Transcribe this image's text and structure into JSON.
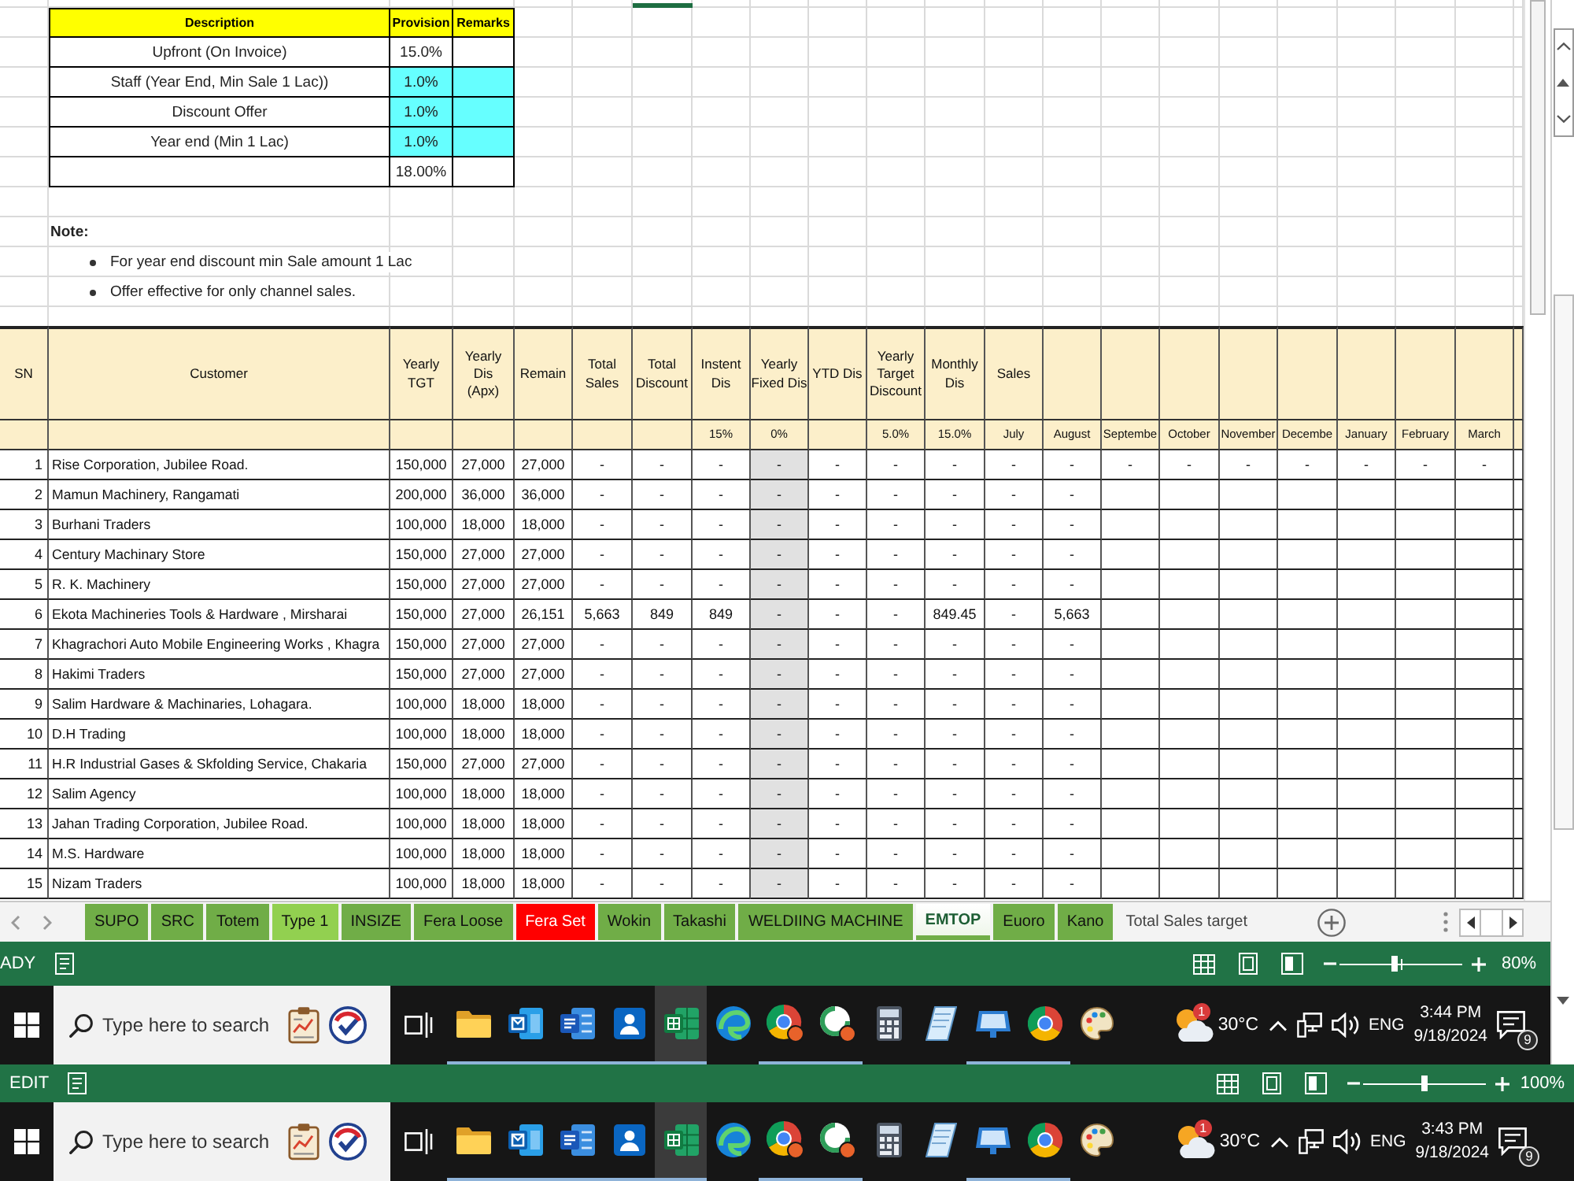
{
  "provision_table": {
    "headers": [
      "Description",
      "Provision",
      "Remarks"
    ],
    "rows": [
      {
        "description": "Upfront (On Invoice)",
        "provision": "15.0%",
        "highlighted": false
      },
      {
        "description": "Staff (Year End, Min Sale 1 Lac))",
        "provision": "1.0%",
        "highlighted": true
      },
      {
        "description": "Discount Offer",
        "provision": "1.0%",
        "highlighted": true
      },
      {
        "description": "Year end (Min 1 Lac)",
        "provision": "1.0%",
        "highlighted": true
      }
    ],
    "total": "18.00%"
  },
  "note": {
    "title": "Note:",
    "bullets": [
      "For year end discount min Sale amount 1 Lac",
      "Offer effective for only channel sales."
    ]
  },
  "table": {
    "columns": [
      {
        "kind": "index",
        "label": "SN",
        "shaded": false
      },
      {
        "kind": "name",
        "label": "Customer",
        "shaded": false
      },
      {
        "kind": "value",
        "label": "Yearly\nTGT",
        "shaded": false
      },
      {
        "kind": "value",
        "label": "Yearly\nDis\n(Apx)",
        "shaded": false
      },
      {
        "kind": "value",
        "label": "Remain",
        "shaded": false
      },
      {
        "kind": "value",
        "label": "Total\nSales",
        "shaded": false
      },
      {
        "kind": "value",
        "label": "Total\nDiscount",
        "shaded": false
      },
      {
        "kind": "value",
        "label": "Instent\nDis",
        "sub": "15%",
        "shaded": false
      },
      {
        "kind": "value",
        "label": "Yearly\nFixed Dis",
        "sub": "0%",
        "shaded": true
      },
      {
        "kind": "value",
        "label": "YTD Dis",
        "shaded": false
      },
      {
        "kind": "value",
        "label": "Yearly\nTarget\nDiscount",
        "sub": "5.0%",
        "shaded": false
      },
      {
        "kind": "value",
        "label": "Monthly\nDis",
        "sub": "15.0%",
        "shaded": false
      },
      {
        "kind": "value",
        "label": "Sales",
        "sub": "July",
        "shaded": false
      },
      {
        "kind": "value",
        "sub": "August",
        "shaded": false
      },
      {
        "kind": "value",
        "sub": "Septembe",
        "shaded": false
      },
      {
        "kind": "value",
        "sub": "October",
        "shaded": false
      },
      {
        "kind": "value",
        "sub": "November",
        "shaded": false
      },
      {
        "kind": "value",
        "sub": "Decembe",
        "shaded": false
      },
      {
        "kind": "value",
        "sub": "January",
        "shaded": false
      },
      {
        "kind": "value",
        "sub": "February",
        "shaded": false
      },
      {
        "kind": "value",
        "sub": "March",
        "shaded": false
      }
    ],
    "rows": [
      {
        "sn": "1",
        "customer": "Rise Corporation, Jubilee Road.",
        "values": [
          "150,000",
          "27,000",
          "27,000",
          "-",
          "-",
          "-",
          "-",
          "-",
          "-",
          "-",
          "-",
          "-",
          "-",
          "-",
          "-",
          "-",
          "-",
          "-",
          "-"
        ]
      },
      {
        "sn": "2",
        "customer": "Mamun Machinery, Rangamati",
        "values": [
          "200,000",
          "36,000",
          "36,000",
          "-",
          "-",
          "-",
          "-",
          "-",
          "-",
          "-",
          "-",
          "-"
        ]
      },
      {
        "sn": "3",
        "customer": "Burhani Traders",
        "values": [
          "100,000",
          "18,000",
          "18,000",
          "-",
          "-",
          "-",
          "-",
          "-",
          "-",
          "-",
          "-",
          "-"
        ]
      },
      {
        "sn": "4",
        "customer": "Century Machinary Store",
        "values": [
          "150,000",
          "27,000",
          "27,000",
          "-",
          "-",
          "-",
          "-",
          "-",
          "-",
          "-",
          "-",
          "-"
        ]
      },
      {
        "sn": "5",
        "customer": "R. K. Machinery",
        "values": [
          "150,000",
          "27,000",
          "27,000",
          "-",
          "-",
          "-",
          "-",
          "-",
          "-",
          "-",
          "-",
          "-"
        ]
      },
      {
        "sn": "6",
        "customer": "Ekota Machineries Tools & Hardware , Mirsharai",
        "values": [
          "150,000",
          "27,000",
          "26,151",
          "5,663",
          "849",
          "849",
          "-",
          "-",
          "-",
          "849.45",
          "-",
          "5,663"
        ]
      },
      {
        "sn": "7",
        "customer": "Khagrachori Auto Mobile Engineering Works , Khagra",
        "values": [
          "150,000",
          "27,000",
          "27,000",
          "-",
          "-",
          "-",
          "-",
          "-",
          "-",
          "-",
          "-",
          "-"
        ]
      },
      {
        "sn": "8",
        "customer": "Hakimi Traders",
        "values": [
          "150,000",
          "27,000",
          "27,000",
          "-",
          "-",
          "-",
          "-",
          "-",
          "-",
          "-",
          "-",
          "-"
        ]
      },
      {
        "sn": "9",
        "customer": "Salim Hardware & Machinaries, Lohagara.",
        "values": [
          "100,000",
          "18,000",
          "18,000",
          "-",
          "-",
          "-",
          "-",
          "-",
          "-",
          "-",
          "-",
          "-"
        ]
      },
      {
        "sn": "10",
        "customer": "D.H Trading",
        "values": [
          "100,000",
          "18,000",
          "18,000",
          "-",
          "-",
          "-",
          "-",
          "-",
          "-",
          "-",
          "-",
          "-"
        ]
      },
      {
        "sn": "11",
        "customer": "H.R Industrial Gases & Skfolding Service, Chakaria",
        "values": [
          "150,000",
          "27,000",
          "27,000",
          "-",
          "-",
          "-",
          "-",
          "-",
          "-",
          "-",
          "-",
          "-"
        ]
      },
      {
        "sn": "12",
        "customer": "Salim Agency",
        "values": [
          "100,000",
          "18,000",
          "18,000",
          "-",
          "-",
          "-",
          "-",
          "-",
          "-",
          "-",
          "-",
          "-"
        ]
      },
      {
        "sn": "13",
        "customer": "Jahan Trading Corporation, Jubilee Road.",
        "values": [
          "100,000",
          "18,000",
          "18,000",
          "-",
          "-",
          "-",
          "-",
          "-",
          "-",
          "-",
          "-",
          "-"
        ]
      },
      {
        "sn": "14",
        "customer": "M.S. Hardware",
        "values": [
          "100,000",
          "18,000",
          "18,000",
          "-",
          "-",
          "-",
          "-",
          "-",
          "-",
          "-",
          "-",
          "-"
        ]
      },
      {
        "sn": "15",
        "customer": "Nizam Traders",
        "values": [
          "100,000",
          "18,000",
          "18,000",
          "-",
          "-",
          "-",
          "-",
          "-",
          "-",
          "-",
          "-",
          "-"
        ]
      }
    ]
  },
  "sheet_tabs": [
    {
      "label": "SUPO",
      "color": "#70ad47",
      "selected": false
    },
    {
      "label": "SRC",
      "color": "#70ad47",
      "selected": false
    },
    {
      "label": "Totem",
      "color": "#70ad47",
      "selected": false
    },
    {
      "label": "Type 1",
      "color": "#92d050",
      "selected": false
    },
    {
      "label": "INSIZE",
      "color": "#70ad47",
      "selected": false
    },
    {
      "label": "Fera Loose",
      "color": "#70ad47",
      "selected": false
    },
    {
      "label": "Fera Set",
      "color": "#ff0000",
      "selected": false
    },
    {
      "label": "Wokin",
      "color": "#70ad47",
      "selected": false
    },
    {
      "label": "Takashi",
      "color": "#70ad47",
      "selected": false
    },
    {
      "label": "WELDIING MACHINE",
      "color": "#70ad47",
      "selected": false
    },
    {
      "label": "EMTOP",
      "color": "#70ad47",
      "selected": true
    },
    {
      "label": "Euoro",
      "color": "#70ad47",
      "selected": false
    },
    {
      "label": "Kano",
      "color": "#70ad47",
      "selected": false
    },
    {
      "label": "Total Sales target",
      "selected": false
    }
  ],
  "footers": [
    {
      "status_bar": {
        "mode": "ADY",
        "zoom": "80%",
        "level": 0.45
      },
      "taskbar": {
        "search": {
          "placeholder": "Type here to search"
        },
        "apps": [
          {
            "kind": "folder",
            "running": true,
            "selected": false
          },
          {
            "kind": "mail",
            "running": true,
            "selected": false
          },
          {
            "kind": "document",
            "running": true,
            "selected": false
          },
          {
            "kind": "profile",
            "running": true,
            "selected": false
          },
          {
            "kind": "spreadsheet",
            "running": true,
            "selected": true
          },
          {
            "kind": "swirl",
            "running": false,
            "selected": false
          },
          {
            "kind": "badgedwheel",
            "running": true,
            "selected": false
          },
          {
            "kind": "badgedring",
            "running": true,
            "selected": false
          },
          {
            "kind": "calculator",
            "running": false,
            "selected": false
          },
          {
            "kind": "notepad",
            "running": false,
            "selected": false
          },
          {
            "kind": "screen",
            "running": true,
            "selected": false
          },
          {
            "kind": "wheel",
            "running": true,
            "selected": false
          },
          {
            "kind": "palette",
            "running": false,
            "selected": false
          }
        ],
        "weather": {
          "badge": "1",
          "temperature": "30°C"
        },
        "language": "ENG",
        "time": "3:44 PM",
        "date": "9/18/2024",
        "notifications": "9"
      }
    },
    {
      "status_bar": {
        "mode": "EDIT",
        "zoom": "100%",
        "level": 0.5
      },
      "taskbar": {
        "search": {
          "placeholder": "Type here to search"
        },
        "apps": [
          {
            "kind": "folder",
            "running": true,
            "selected": false
          },
          {
            "kind": "mail",
            "running": true,
            "selected": false
          },
          {
            "kind": "document",
            "running": true,
            "selected": false
          },
          {
            "kind": "profile",
            "running": true,
            "selected": false
          },
          {
            "kind": "spreadsheet",
            "running": true,
            "selected": true
          },
          {
            "kind": "swirl",
            "running": false,
            "selected": false
          },
          {
            "kind": "badgedwheel",
            "running": true,
            "selected": false
          },
          {
            "kind": "badgedring",
            "running": true,
            "selected": false
          },
          {
            "kind": "calculator",
            "running": false,
            "selected": false
          },
          {
            "kind": "notepad",
            "running": false,
            "selected": false
          },
          {
            "kind": "screen",
            "running": true,
            "selected": false
          },
          {
            "kind": "wheel",
            "running": true,
            "selected": false
          },
          {
            "kind": "palette",
            "running": false,
            "selected": false
          }
        ],
        "weather": {
          "badge": "1",
          "temperature": "30°C"
        },
        "language": "ENG",
        "time": "3:43 PM",
        "date": "9/18/2024",
        "notifications": "9"
      }
    }
  ]
}
